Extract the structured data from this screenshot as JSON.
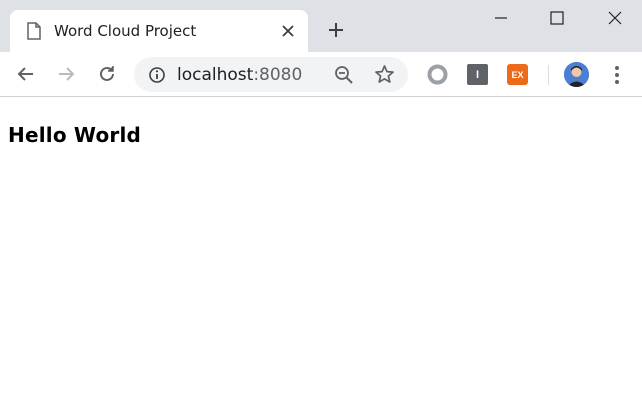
{
  "tab": {
    "title": "Word Cloud Project"
  },
  "address_bar": {
    "host": "localhost",
    "port": ":8080"
  },
  "extensions": [
    {
      "name": "circle-extension",
      "label": ""
    },
    {
      "name": "gray-extension",
      "label": "I"
    },
    {
      "name": "ex-extension",
      "label": "EX"
    }
  ],
  "page": {
    "heading": "Hello World"
  },
  "colors": {
    "tabstrip": "#dee1e6",
    "omnibox": "#f1f3f4",
    "ext_orange": "#ec6a1a",
    "icon_gray": "#5f6368"
  }
}
